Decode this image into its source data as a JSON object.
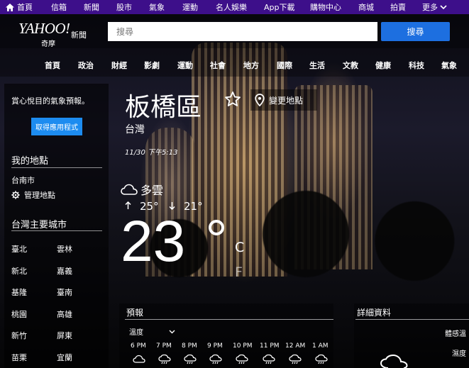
{
  "topbar": {
    "items": [
      "首頁",
      "信箱",
      "新聞",
      "股市",
      "氣象",
      "運動",
      "名人娛樂",
      "App下載",
      "購物中心",
      "商城",
      "拍賣",
      "更多"
    ]
  },
  "header": {
    "logo_text": "YAHOO!",
    "logo_sub1": "奇摩",
    "logo_sub2": "新聞",
    "search_placeholder": "搜尋",
    "search_button": "搜尋"
  },
  "catnav": {
    "items": [
      "首頁",
      "政治",
      "財經",
      "影劇",
      "運動",
      "社會",
      "地方",
      "國際",
      "生活",
      "文教",
      "健康",
      "科技",
      "氣象"
    ]
  },
  "sidebar": {
    "promo": "賞心悅目的氣象預報。",
    "get_app": "取得應用程式",
    "my_locations_title": "我的地點",
    "location": "台南市",
    "manage": "管理地點",
    "major_cities_title": "台灣主要城市",
    "cities": [
      "臺北",
      "雲林",
      "新北",
      "嘉義",
      "基隆",
      "臺南",
      "桃園",
      "高雄",
      "新竹",
      "屏東",
      "苗栗",
      "宜蘭"
    ]
  },
  "weather": {
    "place": "板橋區",
    "country": "台灣",
    "datetime": "11/30 下午5:13",
    "change_location": "變更地點",
    "condition": "多雲",
    "high": "25°",
    "low": "21°",
    "temp": "23",
    "unit_c": "C",
    "unit_f": "F"
  },
  "forecast": {
    "title": "預報",
    "metric": "溫度",
    "hours": [
      "6 PM",
      "7 PM",
      "8 PM",
      "9 PM",
      "10 PM",
      "11 PM",
      "12 AM",
      "1 AM"
    ]
  },
  "details": {
    "title": "詳細資料",
    "feels_like": "體感溫",
    "humidity": "濕度"
  },
  "colors": {
    "topbar": "#3d0f8a",
    "accent_button": "#1d6fe0",
    "app_button": "#1d8cf0"
  }
}
